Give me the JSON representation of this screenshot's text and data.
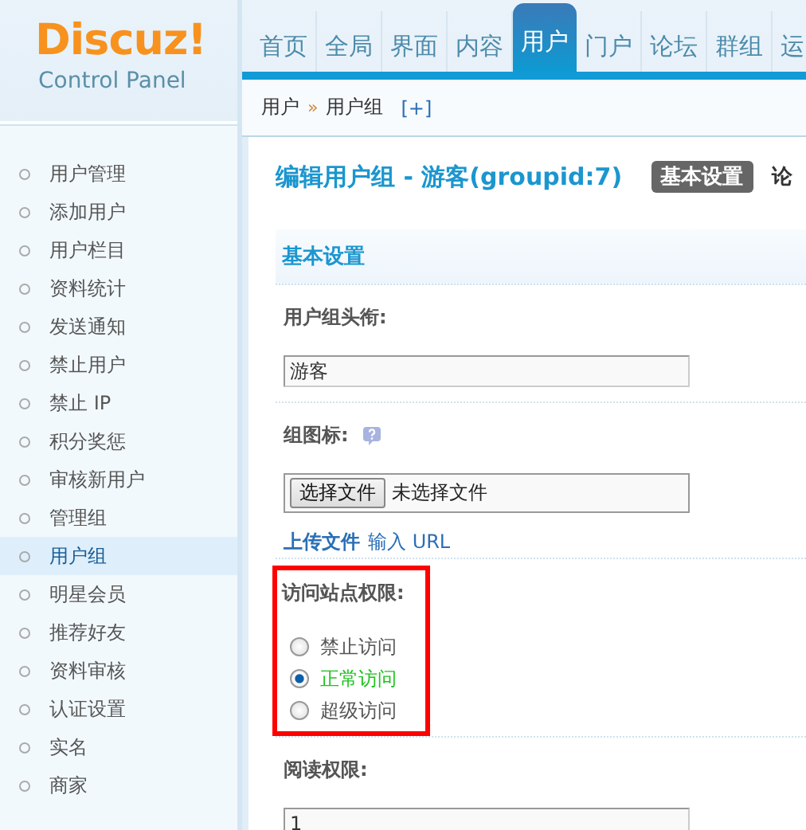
{
  "logo": {
    "brand": "Discuz!",
    "subtitle": "Control Panel"
  },
  "nav": [
    {
      "label": "首页",
      "selected": false
    },
    {
      "label": "全局",
      "selected": false
    },
    {
      "label": "界面",
      "selected": false
    },
    {
      "label": "内容",
      "selected": false
    },
    {
      "label": "用户",
      "selected": true
    },
    {
      "label": "门户",
      "selected": false
    },
    {
      "label": "论坛",
      "selected": false
    },
    {
      "label": "群组",
      "selected": false
    },
    {
      "label": "运",
      "selected": false
    }
  ],
  "breadcrumb": {
    "items": [
      "用户",
      "用户组"
    ],
    "separator": "»",
    "add": "[+]"
  },
  "sidebar": {
    "items": [
      {
        "label": "用户管理",
        "selected": false
      },
      {
        "label": "添加用户",
        "selected": false
      },
      {
        "label": "用户栏目",
        "selected": false
      },
      {
        "label": "资料统计",
        "selected": false
      },
      {
        "label": "发送通知",
        "selected": false
      },
      {
        "label": "禁止用户",
        "selected": false
      },
      {
        "label": "禁止 IP",
        "selected": false
      },
      {
        "label": "积分奖惩",
        "selected": false
      },
      {
        "label": "审核新用户",
        "selected": false
      },
      {
        "label": "管理组",
        "selected": false
      },
      {
        "label": "用户组",
        "selected": true
      },
      {
        "label": "明星会员",
        "selected": false
      },
      {
        "label": "推荐好友",
        "selected": false
      },
      {
        "label": "资料审核",
        "selected": false
      },
      {
        "label": "认证设置",
        "selected": false
      },
      {
        "label": "实名",
        "selected": false
      },
      {
        "label": "商家",
        "selected": false
      }
    ]
  },
  "page": {
    "title": "编辑用户组 - 游客(groupid:7)",
    "tabs": [
      {
        "label": "基本设置",
        "selected": true
      },
      {
        "label": "论",
        "selected": false
      }
    ]
  },
  "section": "基本设置",
  "fields": [
    {
      "kind": "text",
      "label": "用户组头衔:",
      "value": "游客"
    },
    {
      "kind": "file",
      "label": "组图标:",
      "button": "选择文件",
      "status": "未选择文件",
      "links": [
        "上传文件",
        "输入 URL"
      ]
    },
    {
      "kind": "radio",
      "label": "访问站点权限:",
      "highlighted": true,
      "options": [
        {
          "label": "禁止访问",
          "selected": false
        },
        {
          "label": "正常访问",
          "selected": true
        },
        {
          "label": "超级访问",
          "selected": false
        }
      ]
    },
    {
      "kind": "text",
      "label": "阅读权限:",
      "value": "1"
    }
  ]
}
